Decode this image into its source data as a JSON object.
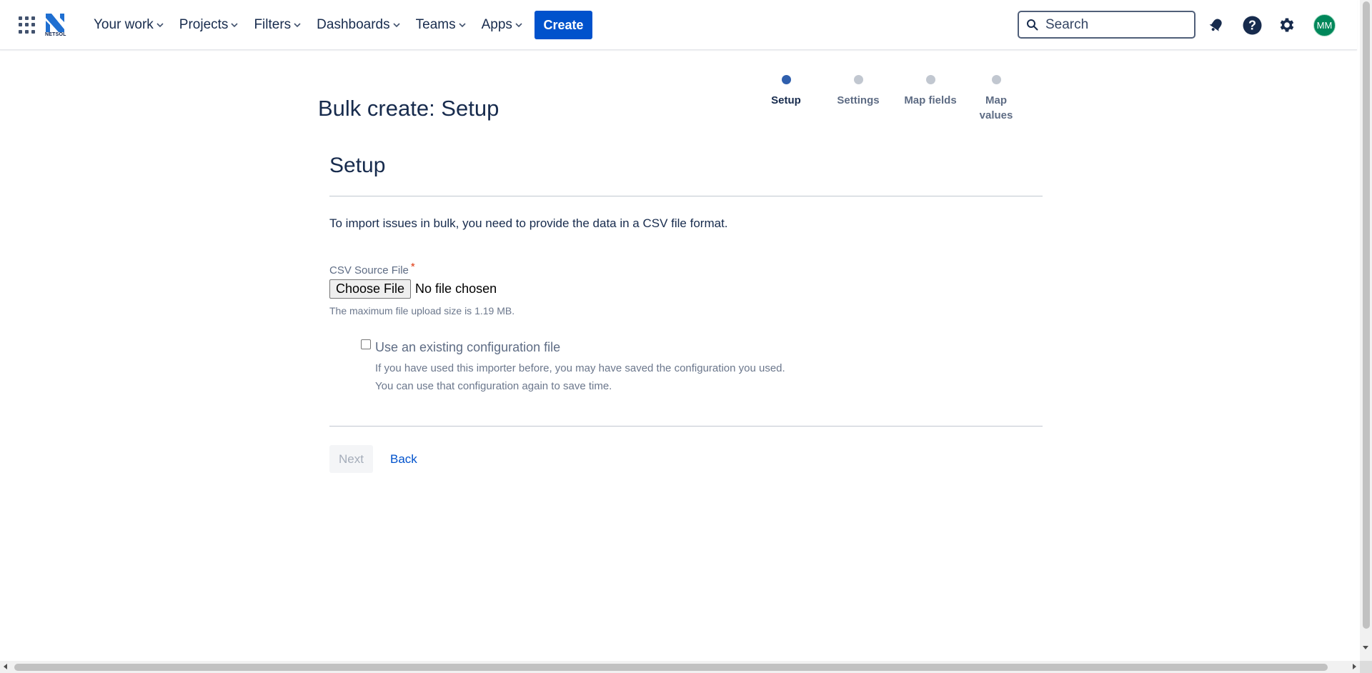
{
  "nav": {
    "logo_text": "NETSOL",
    "items": [
      {
        "label": "Your work"
      },
      {
        "label": "Projects"
      },
      {
        "label": "Filters"
      },
      {
        "label": "Dashboards"
      },
      {
        "label": "Teams"
      },
      {
        "label": "Apps"
      }
    ],
    "create_label": "Create",
    "search_placeholder": "Search",
    "avatar_initials": "MM"
  },
  "page": {
    "title": "Bulk create: Setup",
    "steps": [
      {
        "label": "Setup",
        "active": true
      },
      {
        "label": "Settings",
        "active": false
      },
      {
        "label": "Map fields",
        "active": false
      },
      {
        "label": "Map values",
        "active": false
      }
    ]
  },
  "form": {
    "section_title": "Setup",
    "intro": "To import issues in bulk, you need to provide the data in a CSV file format.",
    "csv_label": "CSV Source File",
    "required_marker": "*",
    "choose_file_label": "Choose File",
    "file_status": "No file chosen",
    "max_size_text": "The maximum file upload size is 1.19 MB.",
    "config_checkbox_label": "Use an existing configuration file",
    "config_checkbox_checked": false,
    "config_desc_line1": "If you have used this importer before, you may have saved the configuration you used.",
    "config_desc_line2": "You can use that configuration again to save time.",
    "next_label": "Next",
    "back_label": "Back"
  },
  "colors": {
    "primary": "#0052cc",
    "text": "#172b4d",
    "subtle": "#5e6c84",
    "avatar": "#00875a",
    "step_active": "#2f5fad",
    "step_inactive": "#c1c7d0"
  }
}
